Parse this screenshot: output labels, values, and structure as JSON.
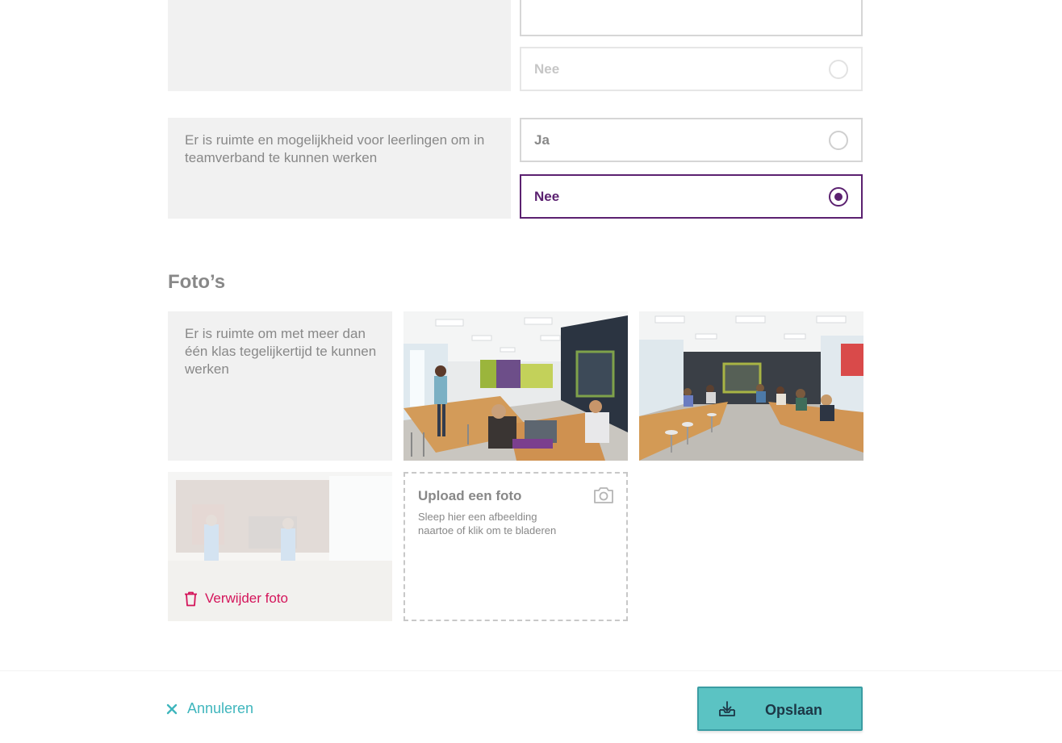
{
  "questions": [
    {
      "text": "",
      "options": [
        {
          "label": "",
          "state": "partial"
        },
        {
          "label": "Nee",
          "state": "faded"
        }
      ]
    },
    {
      "text": "Er is ruimte en mogelijkheid voor leerlingen om in teamverband te kunnen werken",
      "options": [
        {
          "label": "Ja",
          "state": "unselected"
        },
        {
          "label": "Nee",
          "state": "selected"
        }
      ]
    }
  ],
  "photos_section": {
    "title": "Foto’s",
    "question_text": "Er is ruimte om met meer dan één klas tegelijkertijd te kunnen werken",
    "delete_label": "Verwijder foto",
    "upload": {
      "title": "Upload een foto",
      "description": "Sleep hier een afbeelding naartoe of klik om te bladeren"
    }
  },
  "footer": {
    "cancel_label": "Annuleren",
    "save_label": "Opslaan"
  },
  "colors": {
    "accent_purple": "#5b2170",
    "teal": "#5bc3c3",
    "danger": "#d4145a",
    "question_bg": "#f1f1f1"
  },
  "icons": [
    "radio-icon",
    "trash-icon",
    "camera-icon",
    "close-icon",
    "download-tray-icon"
  ]
}
